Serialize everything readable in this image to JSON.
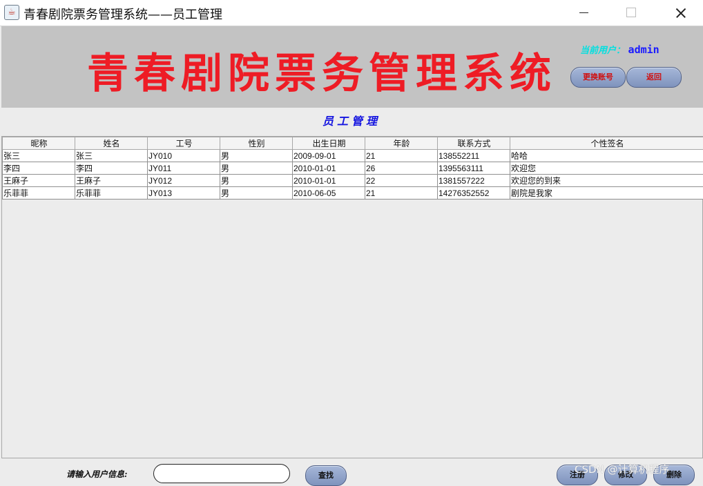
{
  "window": {
    "title": "青春剧院票务管理系统——员工管理",
    "icon": "java-cup-icon"
  },
  "banner": {
    "title": "青春剧院票务管理系统",
    "user_label": "当前用户：",
    "user_name": "admin",
    "switch_account": "更换账号",
    "back": "返回"
  },
  "section_title": "员工管理",
  "table": {
    "columns": [
      "昵称",
      "姓名",
      "工号",
      "性别",
      "出生日期",
      "年龄",
      "联系方式",
      "个性签名"
    ],
    "rows": [
      [
        "张三",
        "张三",
        "JY010",
        "男",
        "2009-09-01",
        "21",
        "138552211",
        "哈哈"
      ],
      [
        "李四",
        "李四",
        "JY011",
        "男",
        "2010-01-01",
        "26",
        "1395563111",
        "欢迎您"
      ],
      [
        "王麻子",
        "王麻子",
        "JY012",
        "男",
        "2010-01-01",
        "22",
        "1381557222",
        "欢迎您的到来"
      ],
      [
        "乐菲菲",
        "乐菲菲",
        "JY013",
        "男",
        "2010-06-05",
        "21",
        "14276352552",
        "剧院是我家"
      ]
    ]
  },
  "bottom": {
    "search_label": "请输入用户信息:",
    "search_value": "",
    "find": "查找",
    "register": "注册",
    "edit": "修改",
    "delete": "删除"
  },
  "watermark": "CSDN @计算机程序",
  "colors": {
    "banner_title": "#ee1c25",
    "banner_bg": "#c3c3c3",
    "section_title": "#1414e0",
    "button": "#8fa2c9"
  }
}
